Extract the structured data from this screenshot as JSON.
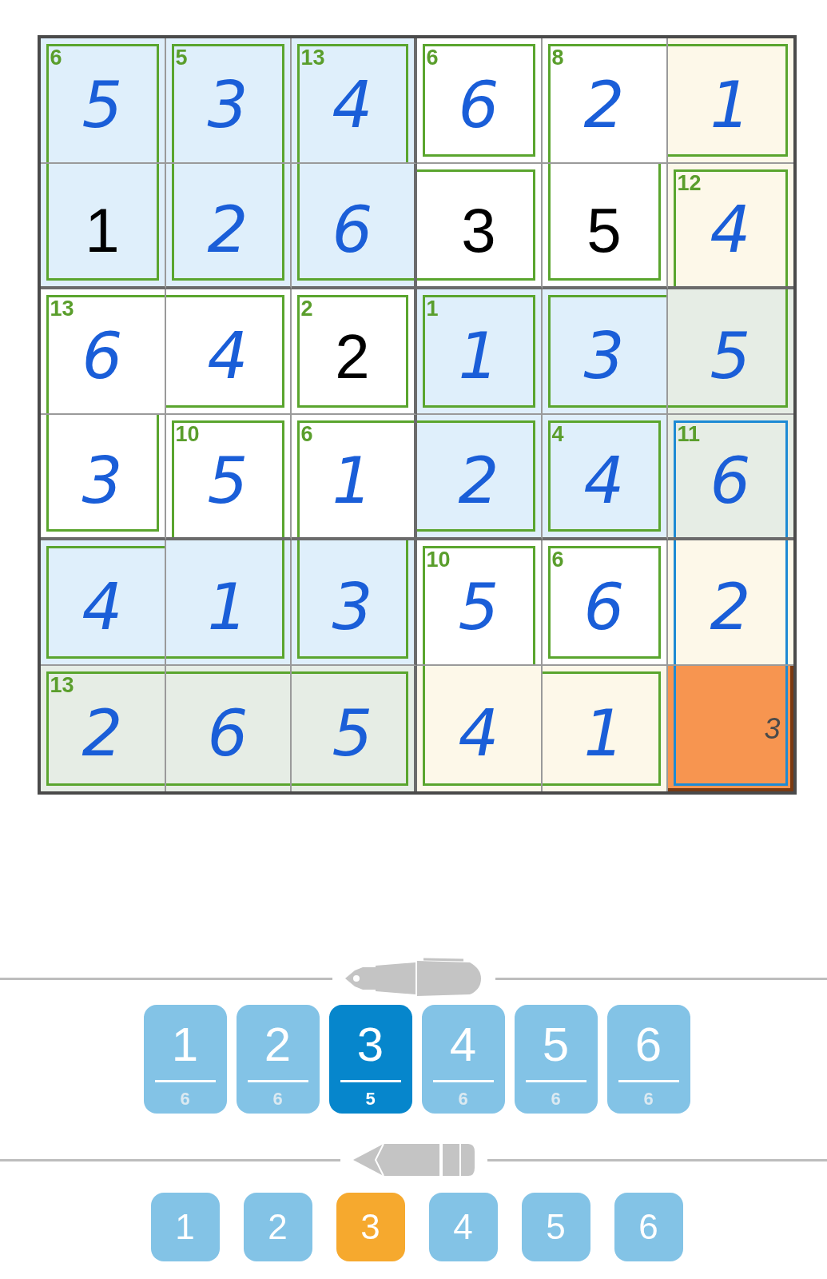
{
  "grid": {
    "cells": [
      {
        "value": "5",
        "kind": "entered",
        "color": "#dfeffb",
        "cage_sum": "6",
        "wall_top": true,
        "wall_right": true,
        "wall_bottom": false,
        "wall_left": true,
        "cage_selected": false,
        "selected": false
      },
      {
        "value": "3",
        "kind": "entered",
        "color": "#dfeffb",
        "cage_sum": "5",
        "wall_top": true,
        "wall_right": true,
        "wall_bottom": false,
        "wall_left": true,
        "cage_selected": false,
        "selected": false
      },
      {
        "value": "4",
        "kind": "entered",
        "color": "#dfeffb",
        "cage_sum": "13",
        "wall_top": true,
        "wall_right": true,
        "wall_bottom": false,
        "wall_left": true,
        "cage_selected": false,
        "selected": false
      },
      {
        "value": "6",
        "kind": "entered",
        "color": "#ffffff",
        "cage_sum": "6",
        "wall_top": true,
        "wall_right": true,
        "wall_bottom": true,
        "wall_left": true,
        "cage_selected": false,
        "selected": false
      },
      {
        "value": "2",
        "kind": "entered",
        "color": "#ffffff",
        "cage_sum": "8",
        "wall_top": true,
        "wall_right": false,
        "wall_bottom": false,
        "wall_left": true,
        "cage_selected": false,
        "selected": false
      },
      {
        "value": "1",
        "kind": "entered",
        "color": "#fdf8e9",
        "wall_top": true,
        "wall_right": true,
        "wall_bottom": true,
        "wall_left": false,
        "cage_selected": false,
        "selected": false
      },
      {
        "value": "1",
        "kind": "given",
        "color": "#dfeffb",
        "wall_top": false,
        "wall_right": true,
        "wall_bottom": true,
        "wall_left": true,
        "cage_selected": false,
        "selected": false
      },
      {
        "value": "2",
        "kind": "entered",
        "color": "#dfeffb",
        "wall_top": false,
        "wall_right": true,
        "wall_bottom": true,
        "wall_left": true,
        "cage_selected": false,
        "selected": false
      },
      {
        "value": "6",
        "kind": "entered",
        "color": "#dfeffb",
        "wall_top": false,
        "wall_right": false,
        "wall_bottom": true,
        "wall_left": true,
        "cage_selected": false,
        "selected": false
      },
      {
        "value": "3",
        "kind": "given",
        "color": "#ffffff",
        "wall_top": true,
        "wall_right": true,
        "wall_bottom": true,
        "wall_left": false,
        "cage_selected": false,
        "selected": false
      },
      {
        "value": "5",
        "kind": "given",
        "color": "#ffffff",
        "wall_top": false,
        "wall_right": true,
        "wall_bottom": true,
        "wall_left": true,
        "cage_selected": false,
        "selected": false
      },
      {
        "value": "4",
        "kind": "entered",
        "color": "#fdf8e9",
        "cage_sum": "12",
        "wall_top": true,
        "wall_right": true,
        "wall_bottom": false,
        "wall_left": true,
        "cage_selected": false,
        "selected": false
      },
      {
        "value": "6",
        "kind": "entered",
        "color": "#ffffff",
        "cage_sum": "13",
        "wall_top": true,
        "wall_right": false,
        "wall_bottom": false,
        "wall_left": true,
        "cage_selected": false,
        "selected": false
      },
      {
        "value": "4",
        "kind": "entered",
        "color": "#ffffff",
        "wall_top": true,
        "wall_right": true,
        "wall_bottom": true,
        "wall_left": false,
        "cage_selected": false,
        "selected": false
      },
      {
        "value": "2",
        "kind": "given",
        "color": "#ffffff",
        "cage_sum": "2",
        "wall_top": true,
        "wall_right": true,
        "wall_bottom": true,
        "wall_left": true,
        "cage_selected": false,
        "selected": false
      },
      {
        "value": "1",
        "kind": "entered",
        "color": "#dfeffb",
        "cage_sum": "1",
        "wall_top": true,
        "wall_right": true,
        "wall_bottom": true,
        "wall_left": true,
        "cage_selected": false,
        "selected": false
      },
      {
        "value": "3",
        "kind": "entered",
        "color": "#dfeffb",
        "wall_top": true,
        "wall_right": false,
        "wall_bottom": true,
        "wall_left": true,
        "cage_selected": false,
        "selected": false
      },
      {
        "value": "5",
        "kind": "entered",
        "color": "#e6ede5",
        "wall_top": false,
        "wall_right": true,
        "wall_bottom": true,
        "wall_left": false,
        "cage_selected": false,
        "selected": false
      },
      {
        "value": "3",
        "kind": "entered",
        "color": "#ffffff",
        "wall_top": false,
        "wall_right": true,
        "wall_bottom": true,
        "wall_left": true,
        "cage_selected": false,
        "selected": false
      },
      {
        "value": "5",
        "kind": "entered",
        "color": "#ffffff",
        "cage_sum": "10",
        "wall_top": true,
        "wall_right": true,
        "wall_bottom": false,
        "wall_left": true,
        "cage_selected": false,
        "selected": false
      },
      {
        "value": "1",
        "kind": "entered",
        "color": "#ffffff",
        "cage_sum": "6",
        "wall_top": true,
        "wall_right": false,
        "wall_bottom": false,
        "wall_left": true,
        "cage_selected": false,
        "selected": false
      },
      {
        "value": "2",
        "kind": "entered",
        "color": "#dfeffb",
        "wall_top": true,
        "wall_right": true,
        "wall_bottom": true,
        "wall_left": false,
        "cage_selected": false,
        "selected": false
      },
      {
        "value": "4",
        "kind": "entered",
        "color": "#dfeffb",
        "cage_sum": "4",
        "wall_top": true,
        "wall_right": true,
        "wall_bottom": true,
        "wall_left": true,
        "cage_selected": false,
        "selected": false
      },
      {
        "value": "6",
        "kind": "entered",
        "color": "#e6ede5",
        "cage_sum": "11",
        "wall_top": true,
        "wall_right": true,
        "wall_bottom": false,
        "wall_left": true,
        "cage_selected": true,
        "selected": false
      },
      {
        "value": "4",
        "kind": "entered",
        "color": "#dfeffb",
        "wall_top": true,
        "wall_right": false,
        "wall_bottom": true,
        "wall_left": true,
        "cage_selected": false,
        "selected": false
      },
      {
        "value": "1",
        "kind": "entered",
        "color": "#dfeffb",
        "wall_top": false,
        "wall_right": true,
        "wall_bottom": true,
        "wall_left": false,
        "cage_selected": false,
        "selected": false
      },
      {
        "value": "3",
        "kind": "entered",
        "color": "#dfeffb",
        "wall_top": false,
        "wall_right": true,
        "wall_bottom": true,
        "wall_left": true,
        "cage_selected": false,
        "selected": false
      },
      {
        "value": "5",
        "kind": "entered",
        "color": "#ffffff",
        "cage_sum": "10",
        "wall_top": true,
        "wall_right": true,
        "wall_bottom": false,
        "wall_left": true,
        "cage_selected": false,
        "selected": false
      },
      {
        "value": "6",
        "kind": "entered",
        "color": "#ffffff",
        "cage_sum": "6",
        "wall_top": true,
        "wall_right": true,
        "wall_bottom": true,
        "wall_left": true,
        "cage_selected": false,
        "selected": false
      },
      {
        "value": "2",
        "kind": "entered",
        "color": "#fdf8e9",
        "wall_top": false,
        "wall_right": true,
        "wall_bottom": false,
        "wall_left": true,
        "cage_selected": true,
        "selected": false
      },
      {
        "value": "2",
        "kind": "entered",
        "color": "#e6ede5",
        "cage_sum": "13",
        "wall_top": true,
        "wall_right": false,
        "wall_bottom": true,
        "wall_left": true,
        "cage_selected": false,
        "selected": false
      },
      {
        "value": "6",
        "kind": "entered",
        "color": "#e6ede5",
        "wall_top": true,
        "wall_right": false,
        "wall_bottom": true,
        "wall_left": false,
        "cage_selected": false,
        "selected": false
      },
      {
        "value": "5",
        "kind": "entered",
        "color": "#e6ede5",
        "wall_top": true,
        "wall_right": true,
        "wall_bottom": true,
        "wall_left": false,
        "cage_selected": false,
        "selected": false
      },
      {
        "value": "4",
        "kind": "entered",
        "color": "#fdf8e9",
        "wall_top": false,
        "wall_right": false,
        "wall_bottom": true,
        "wall_left": true,
        "cage_selected": false,
        "selected": false
      },
      {
        "value": "1",
        "kind": "entered",
        "color": "#fdf8e9",
        "wall_top": true,
        "wall_right": true,
        "wall_bottom": true,
        "wall_left": false,
        "cage_selected": false,
        "selected": false
      },
      {
        "kind": "empty",
        "notes": "3",
        "color": "#f79550",
        "wall_top": false,
        "wall_right": true,
        "wall_bottom": true,
        "wall_left": true,
        "cage_selected": true,
        "selected": true
      }
    ]
  },
  "pen_keys": [
    {
      "digit": "1",
      "count": "6",
      "selected": false
    },
    {
      "digit": "2",
      "count": "6",
      "selected": false
    },
    {
      "digit": "3",
      "count": "5",
      "selected": true
    },
    {
      "digit": "4",
      "count": "6",
      "selected": false
    },
    {
      "digit": "5",
      "count": "6",
      "selected": false
    },
    {
      "digit": "6",
      "count": "6",
      "selected": false
    }
  ],
  "pencil_keys": [
    {
      "digit": "1",
      "selected": false
    },
    {
      "digit": "2",
      "selected": false
    },
    {
      "digit": "3",
      "selected": true
    },
    {
      "digit": "4",
      "selected": false
    },
    {
      "digit": "5",
      "selected": false
    },
    {
      "digit": "6",
      "selected": false
    }
  ]
}
